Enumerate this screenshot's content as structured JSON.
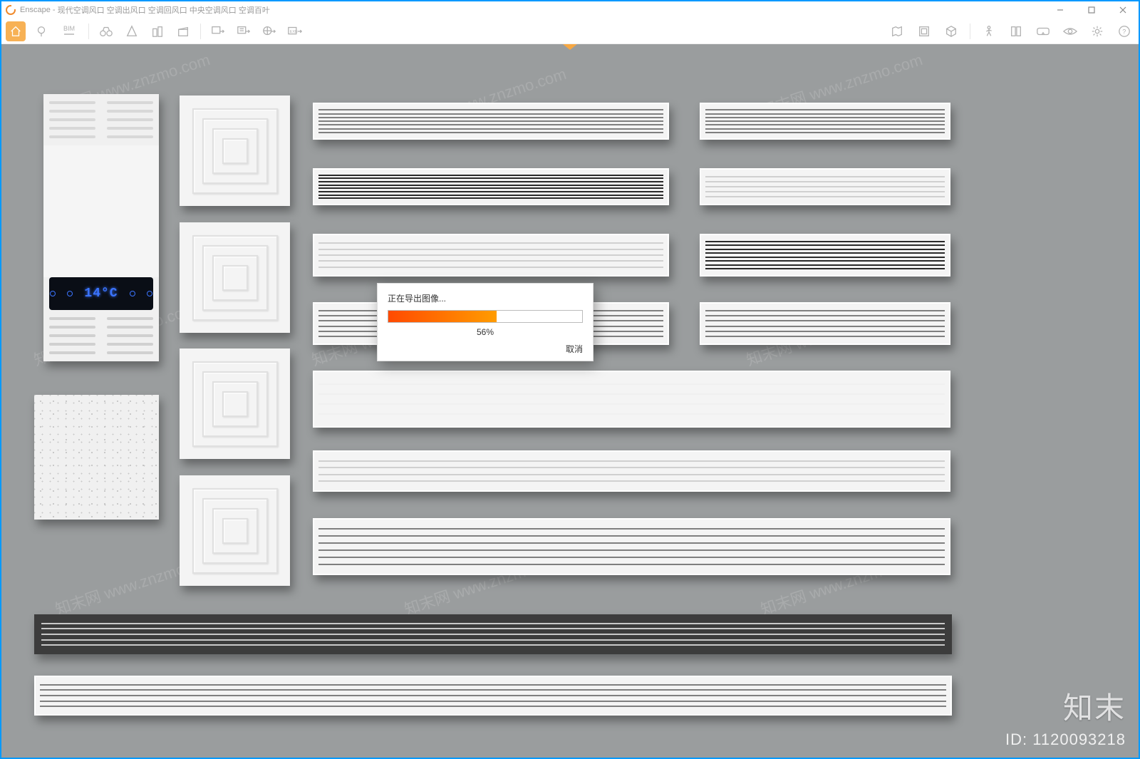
{
  "app": {
    "name": "Enscape",
    "title_suffix": "现代空调风口 空调出风口 空调回风口 中央空调风口 空调百叶"
  },
  "window_controls": {
    "minimize": "—",
    "maximize": "▢",
    "close": "✕"
  },
  "toolbar": {
    "home": "home-icon",
    "pin": "pin-icon",
    "bim_label": "BIM",
    "binoculars": "binoculars-icon",
    "orbit": "orbit-icon",
    "buildings": "buildings-icon",
    "clapper": "clapperboard-icon",
    "export_image": "image-export-icon",
    "export_movie": "movie-export-icon",
    "export_pano": "360-export-icon",
    "export_exe": "exe-export-icon",
    "right": {
      "map": "map-icon",
      "assets": "asset-library-icon",
      "cube": "cube-icon",
      "walk": "walk-icon",
      "layers": "layers-icon",
      "vr": "vr-headset-icon",
      "eye": "eye-icon",
      "gear": "gear-icon",
      "help": "help-icon"
    }
  },
  "dialog": {
    "title": "正在导出图像...",
    "percent_value": 56,
    "percent_label": "56%",
    "cancel_label": "取消"
  },
  "heater": {
    "temperature": "14°C"
  },
  "watermark": {
    "text": "知末网 www.znzmo.com",
    "brand": "知末",
    "id_label": "ID: 1120093218"
  }
}
